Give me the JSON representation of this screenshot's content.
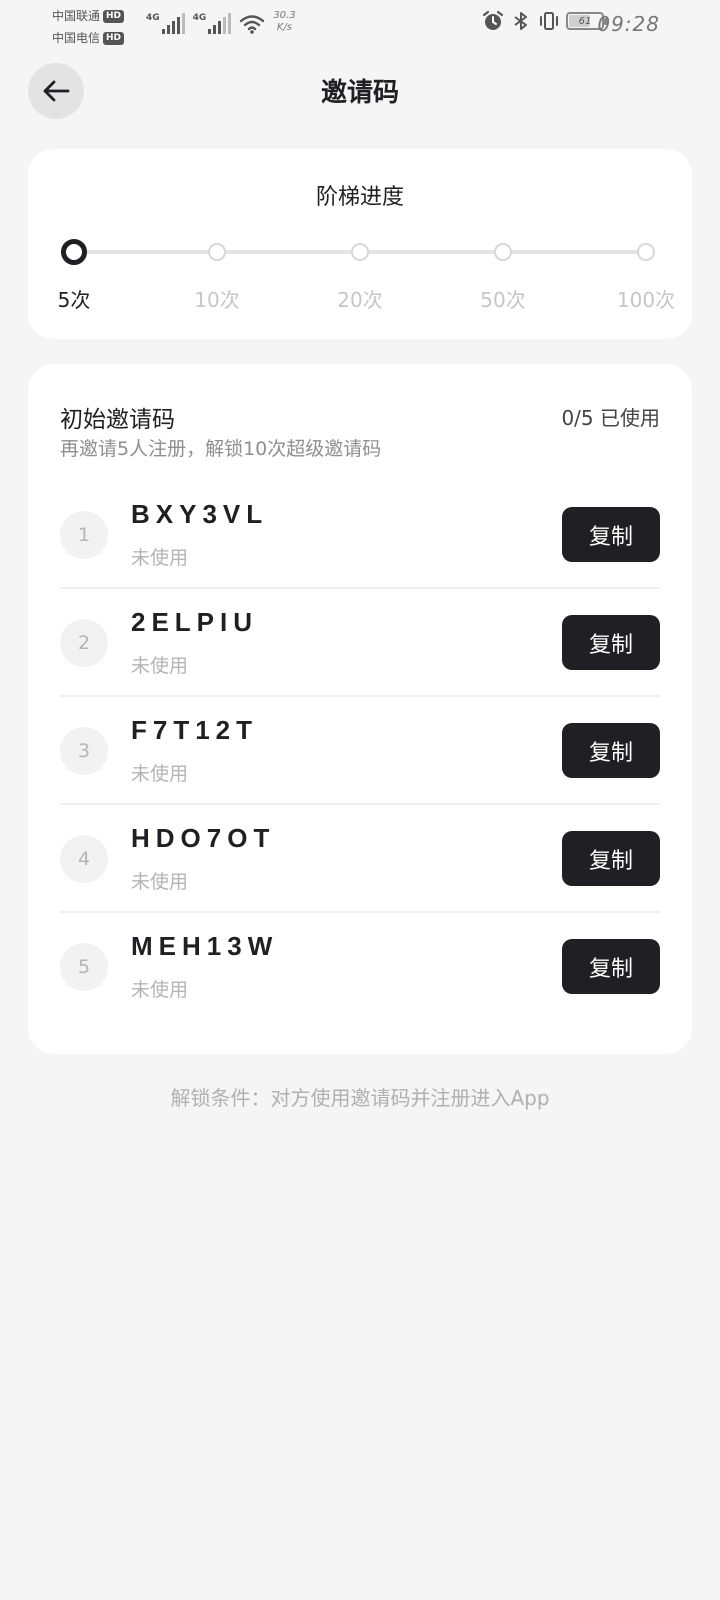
{
  "status_bar": {
    "carrier1": "中国联通",
    "carrier2": "中国电信",
    "hd": "HD",
    "network1": "4G",
    "network2": "4G",
    "speed_value": "30.3",
    "speed_unit": "K/s",
    "battery": "61",
    "time": "09:28"
  },
  "header": {
    "title": "邀请码"
  },
  "progress": {
    "title": "阶梯进度",
    "current_index": 0,
    "steps": [
      {
        "label": "5次"
      },
      {
        "label": "10次"
      },
      {
        "label": "20次"
      },
      {
        "label": "50次"
      },
      {
        "label": "100次"
      }
    ]
  },
  "codes": {
    "title": "初始邀请码",
    "usage": "0/5 已使用",
    "subtitle": "再邀请5人注册，解锁10次超级邀请码",
    "items": [
      {
        "index": "1",
        "code": "BXY3VL",
        "status": "未使用",
        "button": "复制"
      },
      {
        "index": "2",
        "code": "2ELPIU",
        "status": "未使用",
        "button": "复制"
      },
      {
        "index": "3",
        "code": "F7T12T",
        "status": "未使用",
        "button": "复制"
      },
      {
        "index": "4",
        "code": "HDO7OT",
        "status": "未使用",
        "button": "复制"
      },
      {
        "index": "5",
        "code": "MEH13W",
        "status": "未使用",
        "button": "复制"
      }
    ]
  },
  "footer": {
    "note": "解锁条件：对方使用邀请码并注册进入App"
  },
  "colors": {
    "background": "#f5f5f5",
    "card": "#ffffff",
    "primary_dark": "#1f1f24",
    "muted": "#b4b4b4"
  }
}
